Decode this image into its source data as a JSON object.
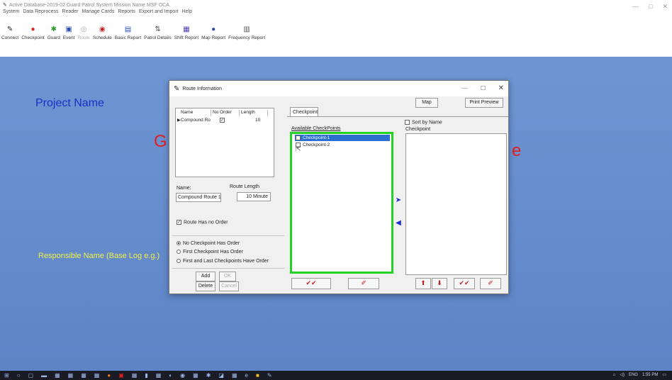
{
  "app": {
    "title": "Active Database-2019-02  Guard Patrol System Mission Name  MSF OCA",
    "window_controls": {
      "minimize": "—",
      "maximize": "□",
      "close": "✕"
    }
  },
  "menu": [
    "System",
    "Data Reprocess",
    "Reader",
    "Manage Cards",
    "Reports",
    "Export and Import",
    "Help"
  ],
  "toolbar": [
    {
      "label": "Connect",
      "icon": "pencil-icon",
      "glyph": "✎",
      "color": "#222"
    },
    {
      "label": "Checkpoint",
      "icon": "checkpoint-icon",
      "glyph": "●",
      "color": "#e02020"
    },
    {
      "label": "Guard",
      "icon": "guard-icon",
      "glyph": "✱",
      "color": "#2a9a2a"
    },
    {
      "label": "Event",
      "icon": "event-icon",
      "glyph": "▣",
      "color": "#2a4fb0"
    },
    {
      "label": "Route",
      "icon": "route-icon",
      "glyph": "◎",
      "color": "#aaa",
      "disabled": true
    },
    {
      "label": "Schedule",
      "icon": "schedule-icon",
      "glyph": "◉",
      "color": "#c02020"
    },
    {
      "label": "Basic Report",
      "icon": "basic-report-icon",
      "glyph": "▤",
      "color": "#2a4fb0"
    },
    {
      "label": "Patrol Details",
      "icon": "patrol-details-icon",
      "glyph": "⇅",
      "color": "#555"
    },
    {
      "label": "Shift Report",
      "icon": "shift-report-icon",
      "glyph": "▦",
      "color": "#4a3fb0"
    },
    {
      "label": "Map Report",
      "icon": "map-report-icon",
      "glyph": "●",
      "color": "#2a4fb0"
    },
    {
      "label": "Frequency Report",
      "icon": "frequency-report-icon",
      "glyph": "▥",
      "color": "#555"
    }
  ],
  "background": {
    "project_name": "Project Name",
    "partial_left": "G",
    "partial_right": "e",
    "responsible_name": "Responsible Name (Base Log e.g.)"
  },
  "dialog": {
    "title": "Route Information",
    "map_button": "Map",
    "print_preview_button": "Print Preview",
    "table": {
      "headers": [
        "Name",
        "No Order",
        "Length"
      ],
      "rows": [
        {
          "name": "Compound Ro",
          "no_order": true,
          "length": "10"
        }
      ]
    },
    "name_label": "Name:",
    "route_length_label": "Route Length",
    "name_value": "Compound Route 1",
    "length_value": "10 Minute",
    "route_has_no_order": "Route Has no Order",
    "order_options": [
      "No Checkpoint Has Order",
      "First Checkpoint Has Order",
      "First and Last Checkpoints Have Order"
    ],
    "selected_order": 0,
    "buttons": {
      "add": "Add",
      "ok": "OK",
      "delete": "Delete",
      "cancel": "Cancel"
    },
    "tab_label": "Checkpoint",
    "available_label": "Available CheckPoints",
    "available": [
      {
        "name": "Checkpoint-1",
        "checked": true,
        "selected": true
      },
      {
        "name": "Checkpoint-2",
        "checked": false,
        "selected": false
      }
    ],
    "sort_by_name": "Sort by Name",
    "right_header": "Checkpoint",
    "add_arrow": "➤",
    "remove_arrow": "◀"
  },
  "taskbar": {
    "tray_text": [
      "ENG",
      "1:55 PM"
    ]
  }
}
